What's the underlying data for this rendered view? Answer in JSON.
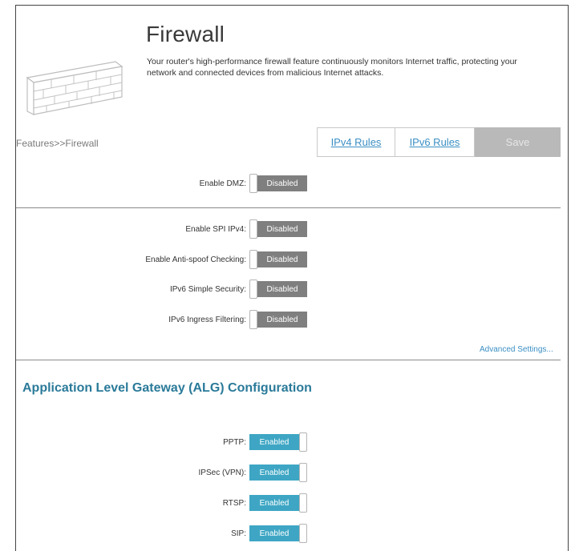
{
  "header": {
    "title": "Firewall",
    "description": "Your router's high-performance firewall feature continuously monitors Internet traffic, protecting your network and connected devices from malicious Internet attacks."
  },
  "breadcrumb": "Features>>Firewall",
  "tabs": [
    {
      "label": "IPv4 Rules"
    },
    {
      "label": "IPv6 Rules"
    }
  ],
  "save_label": "Save",
  "dmz": {
    "label": "Enable DMZ:",
    "state": "Disabled"
  },
  "security": [
    {
      "label": "Enable SPI IPv4:",
      "state": "Disabled"
    },
    {
      "label": "Enable Anti-spoof Checking:",
      "state": "Disabled"
    },
    {
      "label": "IPv6 Simple Security:",
      "state": "Disabled"
    },
    {
      "label": "IPv6 Ingress Filtering:",
      "state": "Disabled"
    }
  ],
  "advanced_link": "Advanced Settings...",
  "alg": {
    "title": "Application Level Gateway (ALG) Configuration",
    "items": [
      {
        "label": "PPTP:",
        "state": "Enabled"
      },
      {
        "label": "IPSec (VPN):",
        "state": "Enabled"
      },
      {
        "label": "RTSP:",
        "state": "Enabled"
      },
      {
        "label": "SIP:",
        "state": "Enabled"
      }
    ]
  },
  "colors": {
    "accent": "#3ea6c4",
    "link": "#3b8fc4",
    "disabled_pill": "#7f7f7f",
    "section_title": "#2a7a99"
  },
  "icons": {
    "header_graphic": "brick-wall-icon"
  }
}
